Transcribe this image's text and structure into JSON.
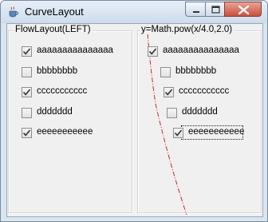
{
  "window": {
    "title": "CurveLayout",
    "accent": "#c43b2b"
  },
  "icons": {
    "app": "java-cup-icon",
    "min": "minimize-icon",
    "max": "maximize-icon",
    "close": "close-icon"
  },
  "left_panel": {
    "title": "FlowLayout(LEFT)",
    "items": [
      {
        "label": "aaaaaaaaaaaaaaa",
        "checked": true
      },
      {
        "label": "bbbbbbbb",
        "checked": false
      },
      {
        "label": "ccccccccccc",
        "checked": true
      },
      {
        "label": "ddddddd",
        "checked": false
      },
      {
        "label": "eeeeeeeeeee",
        "checked": true
      }
    ]
  },
  "right_panel": {
    "title": "y=Math.pow(x/4.0,2.0)",
    "curve_color": "#d2232a",
    "items": [
      {
        "label": "aaaaaaaaaaaaaaa",
        "checked": true
      },
      {
        "label": "bbbbbbbb",
        "checked": false
      },
      {
        "label": "ccccccccccc",
        "checked": true
      },
      {
        "label": "ddddddd",
        "checked": false
      },
      {
        "label": "eeeeeeeeeee",
        "checked": true,
        "focused": true
      }
    ]
  }
}
